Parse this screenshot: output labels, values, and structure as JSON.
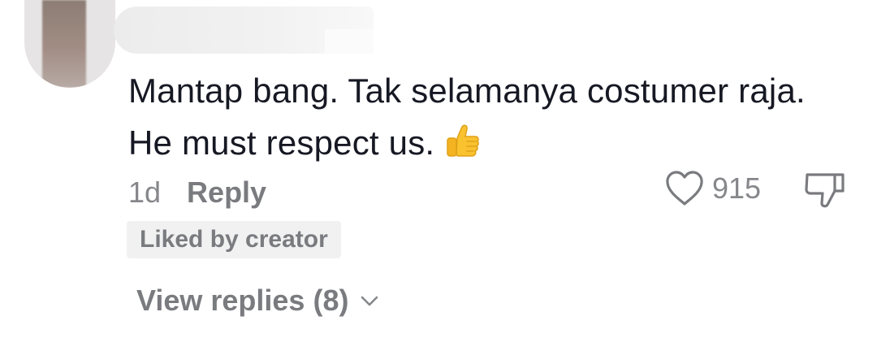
{
  "comment": {
    "line1": "Mantap bang. Tak selamanya costumer raja.",
    "line2": "He must respect us.",
    "emoji": "thumbs-up-emoji",
    "timestamp": "1d",
    "reply_label": "Reply",
    "like_count": "915",
    "liked_badge": "Liked by creator",
    "view_replies_label": "View replies (8)"
  },
  "icons": {
    "like": "heart-icon",
    "dislike": "thumbs-down-icon",
    "expand": "chevron-down-icon"
  },
  "colors": {
    "text_primary": "#161823",
    "text_secondary": "#86878b",
    "badge_background": "#f1f1f2",
    "emoji_yellow": "#f9c22e"
  }
}
